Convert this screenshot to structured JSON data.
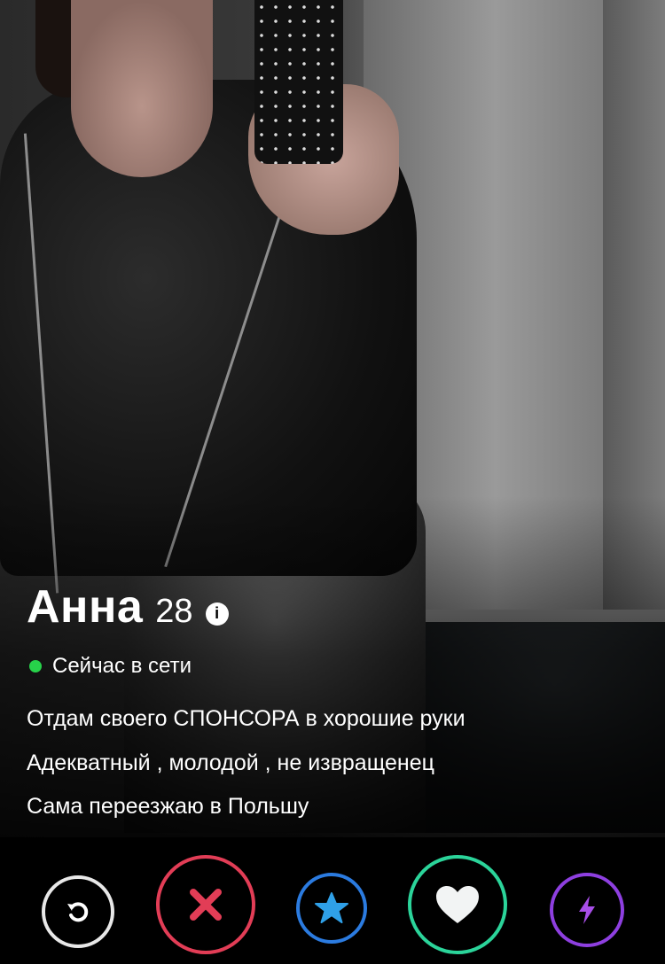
{
  "profile": {
    "name": "Анна",
    "age": "28",
    "status": "Сейчас в сети",
    "bio": [
      "Отдам своего СПОНСОРА в хорошие руки",
      "Адекватный , молодой , не извращенец",
      "Сама переезжаю в Польшу"
    ]
  },
  "colors": {
    "online": "#27d24a",
    "nope": "#e23d56",
    "super_like": "#2b7be0",
    "like": "#2bd49a",
    "boost": "#8e3fe0",
    "rewind": "#e8e8e8"
  },
  "icons": {
    "info": "info-icon",
    "rewind": "rewind-icon",
    "nope": "close-icon",
    "super_like": "star-icon",
    "like": "heart-icon",
    "boost": "lightning-icon"
  }
}
